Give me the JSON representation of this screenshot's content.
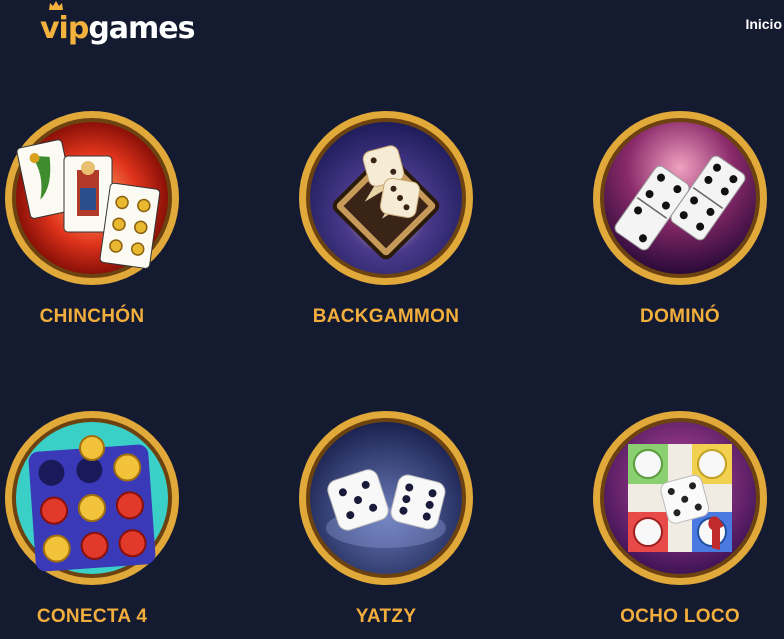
{
  "header": {
    "logo": {
      "vip": "vip",
      "games": "games"
    },
    "nav": {
      "home_label": "Inicio"
    }
  },
  "colors": {
    "background": "#141b30",
    "title_gold": "#f2ae3c",
    "ring_gold": "#e1a83a"
  },
  "games": [
    {
      "title": "CHINCHÓN",
      "icon": "spanish-cards-icon"
    },
    {
      "title": "BACKGAMMON",
      "icon": "backgammon-icon"
    },
    {
      "title": "DOMINÓ",
      "icon": "domino-icon"
    },
    {
      "title": "CONECTA 4",
      "icon": "connect-four-icon"
    },
    {
      "title": "YATZY",
      "icon": "dice-icon"
    },
    {
      "title": "OCHO LOCO",
      "icon": "ludo-board-icon"
    }
  ]
}
